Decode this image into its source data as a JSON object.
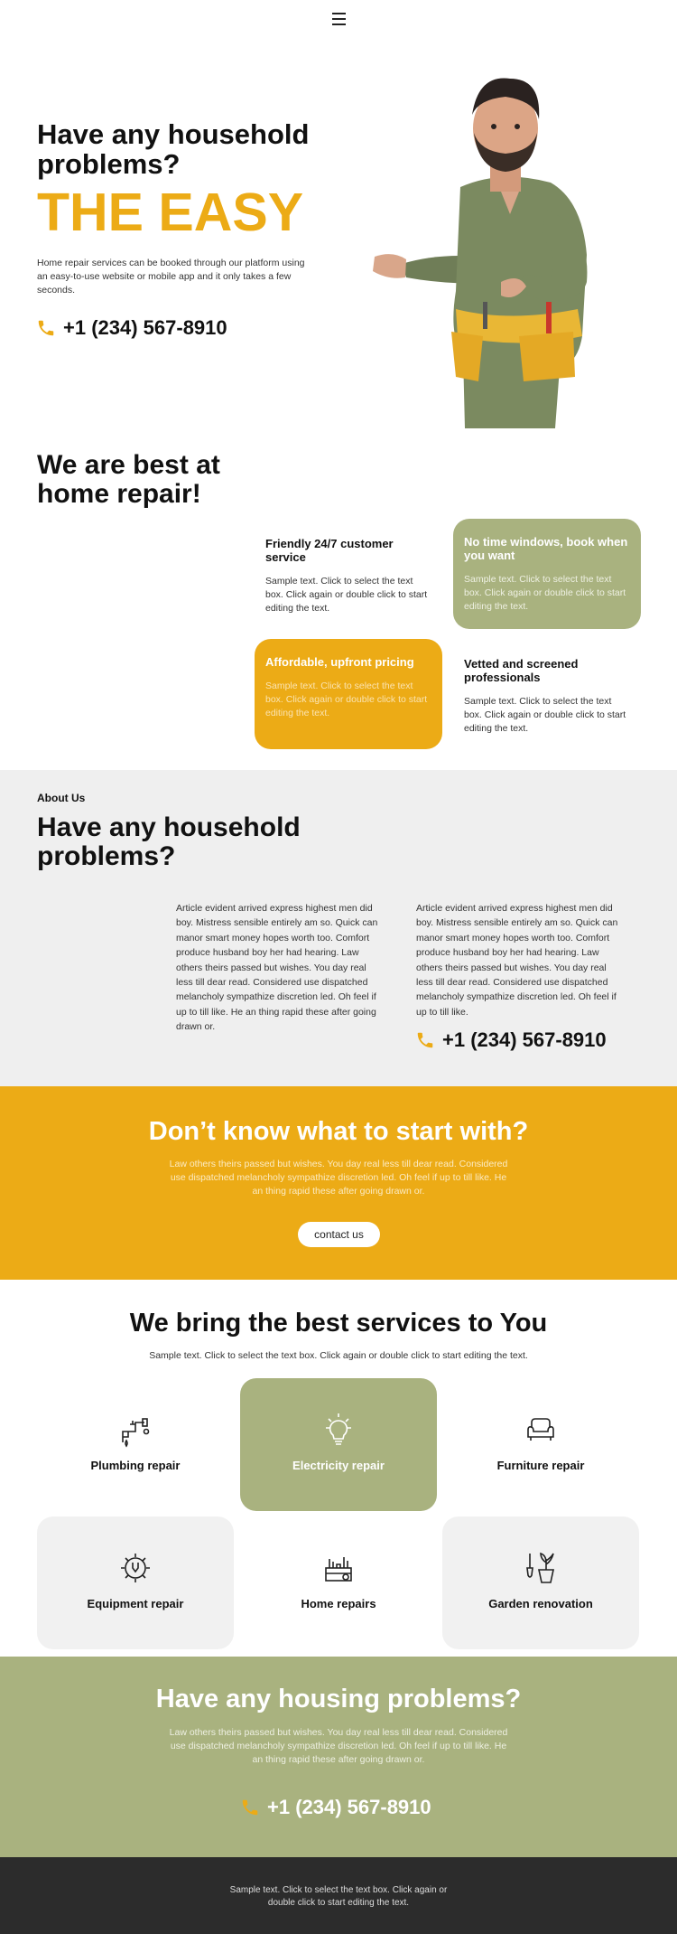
{
  "header": {
    "menu_icon": "hamburger-menu-icon"
  },
  "hero": {
    "title": "Have any household problems?",
    "highlight": "THE EASY",
    "description": "Home repair services can be booked through our platform using an easy-to-use website or mobile app and it only takes a few seconds.",
    "phone": "+1 (234) 567-8910",
    "image_icon": "handyman-photo"
  },
  "best": {
    "title": "We are best at home repair!",
    "cards": [
      {
        "title": "Friendly 24/7 customer service",
        "text": "Sample text. Click to select the text box. Click again or double click to start editing the text."
      },
      {
        "title": "No time windows, book when you want",
        "text": "Sample text. Click to select the text box. Click again or double click to start editing the text."
      },
      {
        "title": "Affordable, upfront pricing",
        "text": "Sample text. Click to select the text box. Click again or double click to start editing the text."
      },
      {
        "title": "Vetted and screened professionals",
        "text": "Sample text. Click to select the text box. Click again or double click to start editing the text."
      }
    ]
  },
  "about": {
    "label": "About Us",
    "title": "Have any household problems?",
    "text_left": "Article evident arrived express highest men did boy. Mistress sensible entirely am so. Quick can manor smart money hopes worth too. Comfort produce husband boy her had hearing. Law others theirs passed but wishes. You day real less till dear read. Considered use dispatched melancholy sympathize discretion led. Oh feel if up to till like. He an thing rapid these after going drawn or.",
    "text_right": "Article evident arrived express highest men did boy. Mistress sensible entirely am so. Quick can manor smart money hopes worth too. Comfort produce husband boy her had hearing. Law others theirs passed but wishes. You day real less till dear read. Considered use dispatched melancholy sympathize discretion led. Oh feel if up to till like.",
    "phone": "+1 (234) 567-8910"
  },
  "cta": {
    "title": "Don’t know what to start with?",
    "description": "Law others theirs passed but wishes. You day real less till dear read. Considered use dispatched melancholy sympathize discretion led. Oh feel if up to till like. He an thing rapid these after going drawn or.",
    "button": "contact us"
  },
  "services": {
    "title": "We bring the best services to You",
    "description": "Sample text. Click to select the text box. Click again or double click to start editing the text.",
    "items": [
      {
        "label": "Plumbing repair",
        "icon": "plumbing-pipe-icon"
      },
      {
        "label": "Electricity repair",
        "icon": "lightbulb-icon"
      },
      {
        "label": "Furniture repair",
        "icon": "armchair-icon"
      },
      {
        "label": "Equipment repair",
        "icon": "gear-wrench-icon"
      },
      {
        "label": "Home repairs",
        "icon": "toolbox-icon"
      },
      {
        "label": "Garden renovation",
        "icon": "plant-pot-shovel-icon"
      }
    ]
  },
  "housing": {
    "title": "Have any housing problems?",
    "description": "Law others theirs passed but wishes. You day real less till dear read. Considered use dispatched melancholy sympathize discretion led. Oh feel if up to till like. He an thing rapid these after going drawn or.",
    "phone": "+1 (234) 567-8910"
  },
  "footer": {
    "text": "Sample text. Click to select the text box. Click again or double click to start editing the text."
  },
  "colors": {
    "accent": "#ecab16",
    "green": "#a9b27f",
    "grey": "#efefef",
    "footer": "#2c2c2c"
  }
}
